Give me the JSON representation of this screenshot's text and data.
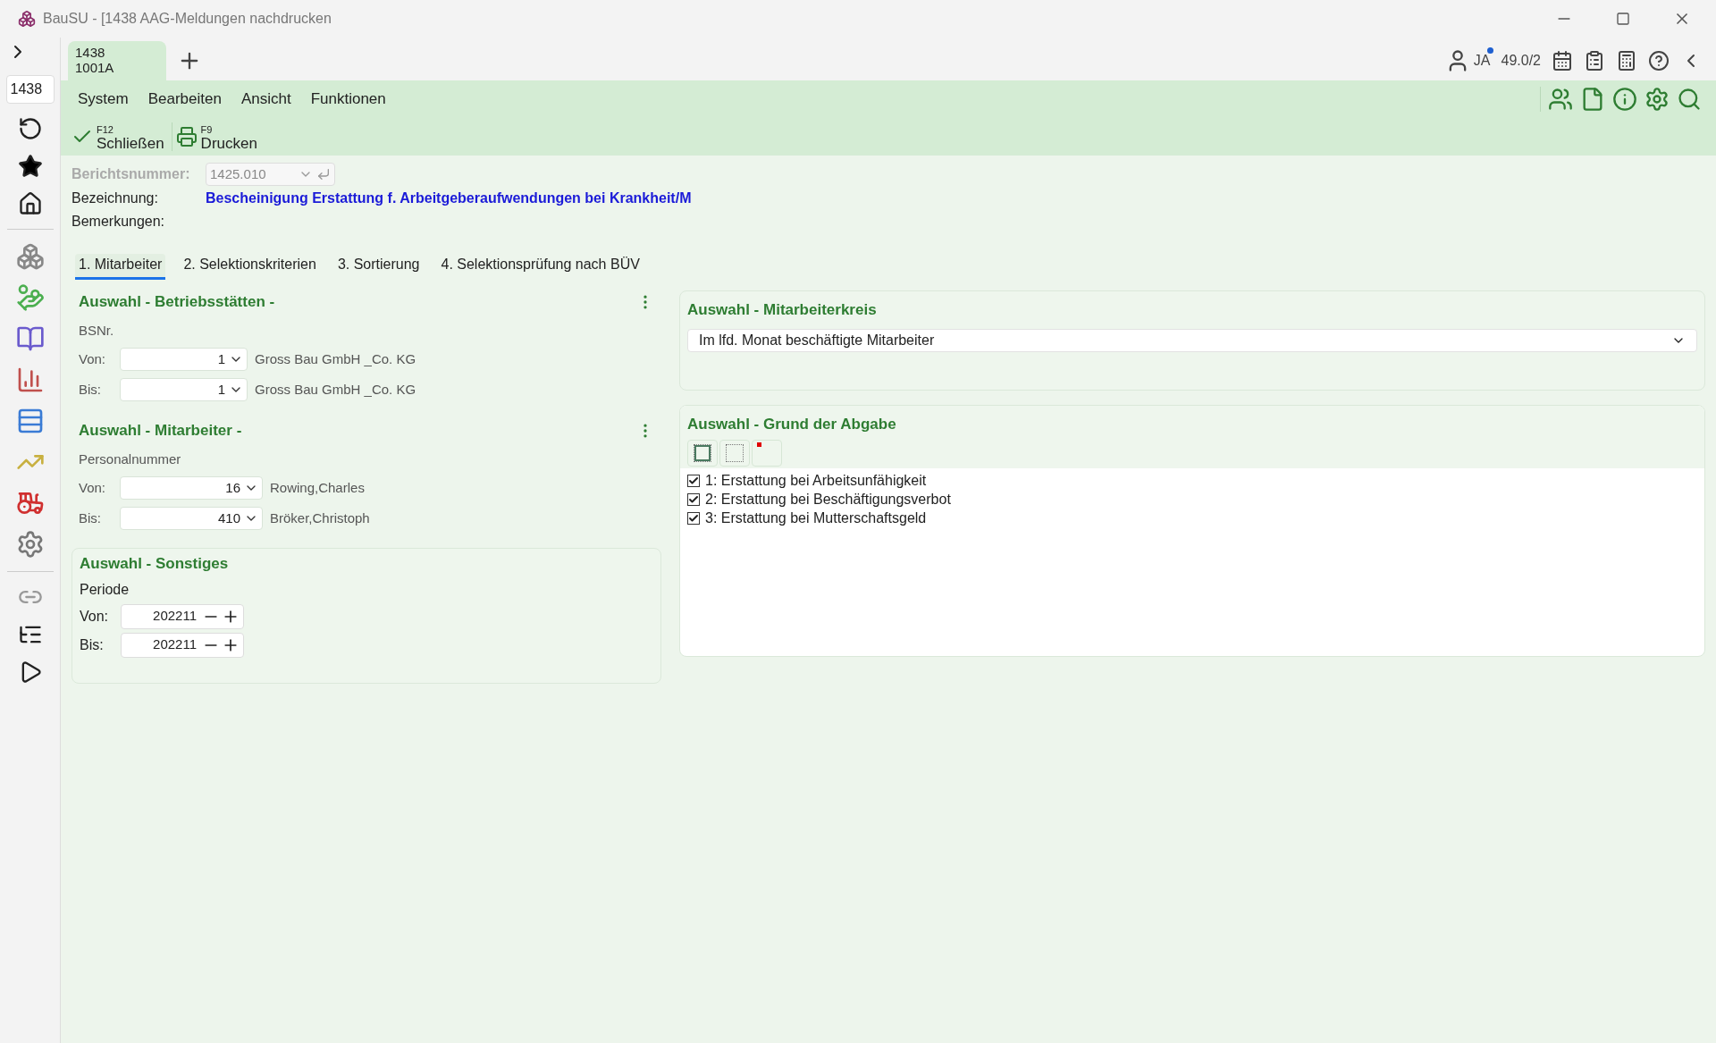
{
  "window": {
    "title": "BauSU - [1438 AAG-Meldungen nachdrucken"
  },
  "sidebar": {
    "field": "1438"
  },
  "doc_tabs": [
    {
      "line1": "1438",
      "line2": "1001A",
      "selected": true
    }
  ],
  "status": {
    "user": "JA",
    "notification": true,
    "version": "49.0/2"
  },
  "menu": [
    "System",
    "Bearbeiten",
    "Ansicht",
    "Funktionen"
  ],
  "toolbar": [
    {
      "kind": "close",
      "key": "F12",
      "label": "Schließen"
    },
    {
      "kind": "print",
      "key": "F9",
      "label": "Drucken"
    }
  ],
  "form": {
    "report_number": {
      "label": "Berichtsnummer:",
      "value": "1425.010",
      "disabled": true
    },
    "designation": {
      "label": "Bezeichnung:",
      "value": "Bescheinigung Erstattung f. Arbeitgeberaufwendungen bei Krankheit/M"
    },
    "remarks": {
      "label": "Bemerkungen:"
    }
  },
  "tabs": [
    {
      "label": "1. Mitarbeiter",
      "selected": true
    },
    {
      "label": "2. Selektionskriterien",
      "selected": false
    },
    {
      "label": "3. Sortierung",
      "selected": false
    },
    {
      "label": "4. Selektionsprüfung nach BÜV",
      "selected": false
    }
  ],
  "left_sections": [
    {
      "title": "Auswahl - Betriebsstätten -",
      "sublabel": "BSNr.",
      "rows": [
        {
          "label": "Von:",
          "value": "1",
          "name": "Gross Bau GmbH _Co. KG"
        },
        {
          "label": "Bis:",
          "value": "1",
          "name": "Gross Bau GmbH _Co. KG"
        }
      ]
    },
    {
      "title": "Auswahl - Mitarbeiter -",
      "sublabel": "Personalnummer",
      "rows": [
        {
          "label": "Von:",
          "value": "16",
          "name": "Rowing,Charles"
        },
        {
          "label": "Bis:",
          "value": "410",
          "name": "Bröker,Christoph"
        }
      ]
    }
  ],
  "other": {
    "title": "Auswahl - Sonstiges",
    "sublabel": "Periode",
    "rows": [
      {
        "label": "Von:",
        "value": "202211"
      },
      {
        "label": "Bis:",
        "value": "202211"
      }
    ]
  },
  "employee_group": {
    "title": "Auswahl - Mitarbeiterkreis",
    "value": "Im lfd. Monat beschäftigte Mitarbeiter"
  },
  "reason": {
    "title": "Auswahl - Grund der Abgabe",
    "items": [
      {
        "label": "1: Erstattung bei Arbeitsunfähigkeit",
        "checked": true
      },
      {
        "label": "2: Erstattung bei Beschäftigungsverbot",
        "checked": true
      },
      {
        "label": "3: Erstattung bei Mutterschaftsgeld",
        "checked": true
      }
    ]
  }
}
